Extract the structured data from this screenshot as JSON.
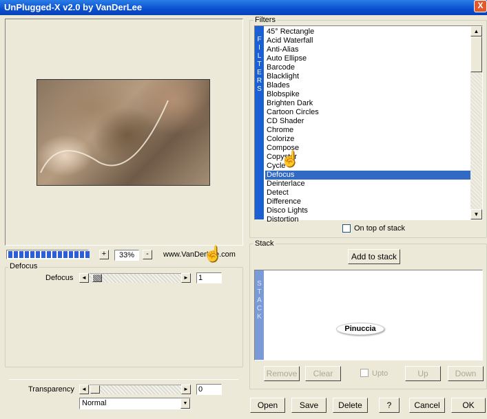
{
  "window": {
    "title": "UnPlugged-X v2.0 by VanDerLee",
    "close_label": "X"
  },
  "preview": {
    "zoom_minus": "-",
    "zoom_plus": "+",
    "zoom_value": "33%",
    "website": "www.VanDerLee.com",
    "progress_percent": 100
  },
  "filter_panel": {
    "group_label": "Defocus",
    "param_label": "Defocus",
    "param_value": "1",
    "left_arrow": "◄",
    "right_arrow": "►"
  },
  "transparency": {
    "label": "Transparency",
    "value": "0",
    "blend_mode": "Normal",
    "dropdown_arrow": "▼"
  },
  "filters": {
    "group_label": "Filters",
    "vertical_label": "FILTERS",
    "items": [
      "45° Rectangle",
      "Acid Waterfall",
      "Anti-Alias",
      "Auto Ellipse",
      "Barcode",
      "Blacklight",
      "Blades",
      "Blobspike",
      "Brighten Dark",
      "Cartoon Circles",
      "CD Shader",
      "Chrome",
      "Colorize",
      "Compose",
      "Copystar",
      "Cycle",
      "Defocus",
      "Deinterlace",
      "Detect",
      "Difference",
      "Disco Lights",
      "Distortion"
    ],
    "selected": "Defocus",
    "on_top_label": "On top of stack",
    "scroll_up": "▲",
    "scroll_down": "▼"
  },
  "stack": {
    "group_label": "Stack",
    "add_button": "Add to stack",
    "vertical_label": "STACK",
    "watermark": "Pinuccia",
    "remove_button": "Remove",
    "clear_button": "Clear",
    "upto_label": "Upto",
    "up_button": "Up",
    "down_button": "Down"
  },
  "footer": {
    "open": "Open",
    "save": "Save",
    "delete": "Delete",
    "help": "?",
    "cancel": "Cancel",
    "ok": "OK"
  },
  "icons": {
    "pointer": "pointing-hand-icon"
  },
  "colors": {
    "title_bar": "#0a4fd0",
    "selection": "#316ac5",
    "filter_bar": "#1a5fd4",
    "stack_bar": "#7a9ad8",
    "progress": "#2b5ed8"
  }
}
